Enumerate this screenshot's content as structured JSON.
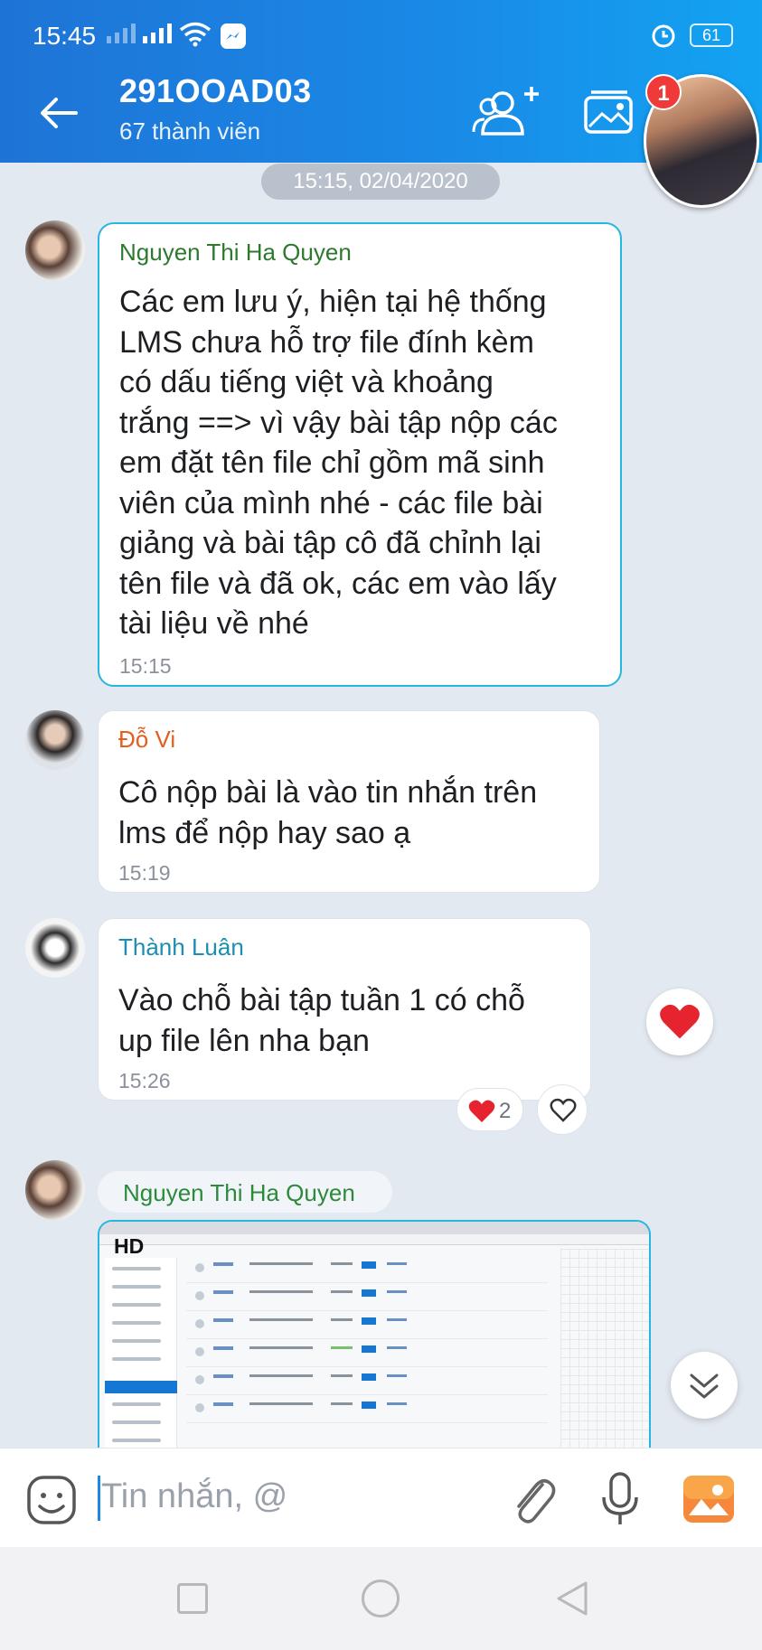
{
  "status_bar": {
    "time": "15:45",
    "battery": "61"
  },
  "header": {
    "group_name": "291OOAD03",
    "member_count": "67 thành viên",
    "notification_badge": "1"
  },
  "date_separator": "15:15, 02/04/2020",
  "messages": [
    {
      "sender": "Nguyen Thi Ha Quyen",
      "sender_color": "#2d7a2e",
      "lines": [
        "Các em lưu ý, hiện tại hệ thống",
        "LMS chưa hỗ trợ file đính kèm",
        "có dấu tiếng việt và khoảng",
        "trắng ==> vì vậy bài tập nộp các",
        "em đặt tên file chỉ gồm mã sinh",
        "viên của mình nhé - các file bài",
        "giảng và bài tập cô đã chỉnh lại",
        "tên file và đã ok, các em vào lấy",
        "tài liệu về nhé"
      ],
      "time": "15:15"
    },
    {
      "sender": "Đỗ Vi",
      "sender_color": "#e2601e",
      "lines": [
        "Cô nộp bài là vào tin nhắn trên",
        "lms để nộp hay sao ạ"
      ],
      "time": "15:19"
    },
    {
      "sender": "Thành Luân",
      "sender_color": "#1c8fb0",
      "lines": [
        "Vào chỗ bài tập tuần 1 có chỗ",
        "up file lên nha bạn"
      ],
      "time": "15:26",
      "reaction_count": "2"
    },
    {
      "sender": "Nguyen Thi Ha Quyen",
      "sender_color": "#2d7a2e",
      "image_label": "HD"
    }
  ],
  "input": {
    "placeholder": "Tin nhắn, @"
  },
  "colors": {
    "header_gradient_start": "#1e74d6",
    "header_gradient_end": "#13a3f2",
    "highlight_border": "#26b6e0",
    "background": "#e3e9f1",
    "heart": "#e5242f"
  }
}
